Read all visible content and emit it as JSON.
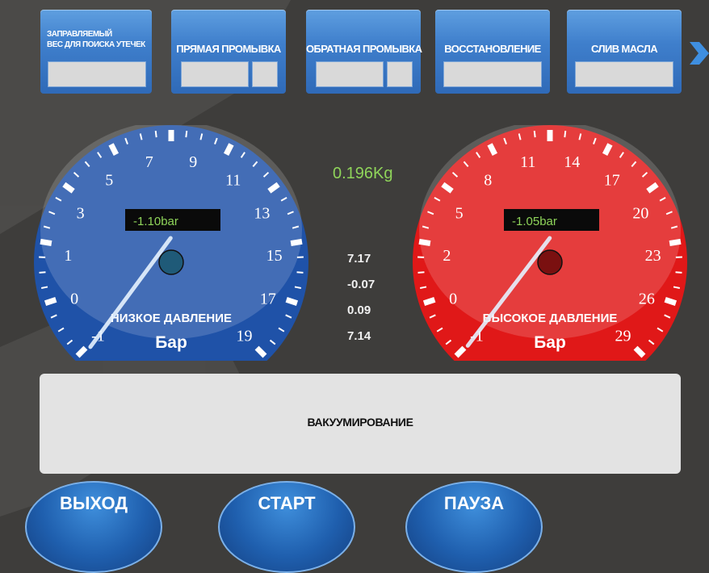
{
  "tabs": [
    {
      "label": "ЗАПРАВЛЯЕМЫЙ\nВЕС ДЛЯ ПОИСКА УТЕЧЕК"
    },
    {
      "label": "ПРЯМАЯ ПРОМЫВКА"
    },
    {
      "label": "ОБРАТНАЯ ПРОМЫВКА"
    },
    {
      "label": "ВОССТАНОВЛЕНИЕ"
    },
    {
      "label": "СЛИВ МАСЛА"
    }
  ],
  "weight": "0.196Kg",
  "readings": [
    "7.17",
    "-0.07",
    "0.09",
    "7.14"
  ],
  "gauges": {
    "low": {
      "display": "-1.10bar",
      "title": "НИЗКОЕ ДАВЛЕНИЕ",
      "unit": "Бар",
      "scale": [
        "-1",
        "0",
        "1",
        "3",
        "5",
        "7",
        "9",
        "11",
        "13",
        "15",
        "17",
        "19"
      ],
      "value": -1.1,
      "min": -1,
      "max": 19,
      "color": "#1f52a8"
    },
    "high": {
      "display": "-1.05bar",
      "title": "ВЫСОКОЕ ДАВЛЕНИЕ",
      "unit": "Бар",
      "scale": [
        "-1",
        "0",
        "2",
        "5",
        "8",
        "11",
        "14",
        "17",
        "20",
        "23",
        "26",
        "29"
      ],
      "value": -1.05,
      "min": -1,
      "max": 29,
      "color": "#e01818"
    }
  },
  "status_text": "ВАКУУМИРОВАНИЕ",
  "buttons": {
    "exit": "ВЫХОД",
    "start": "СТАРТ",
    "pause": "ПАУЗА"
  }
}
